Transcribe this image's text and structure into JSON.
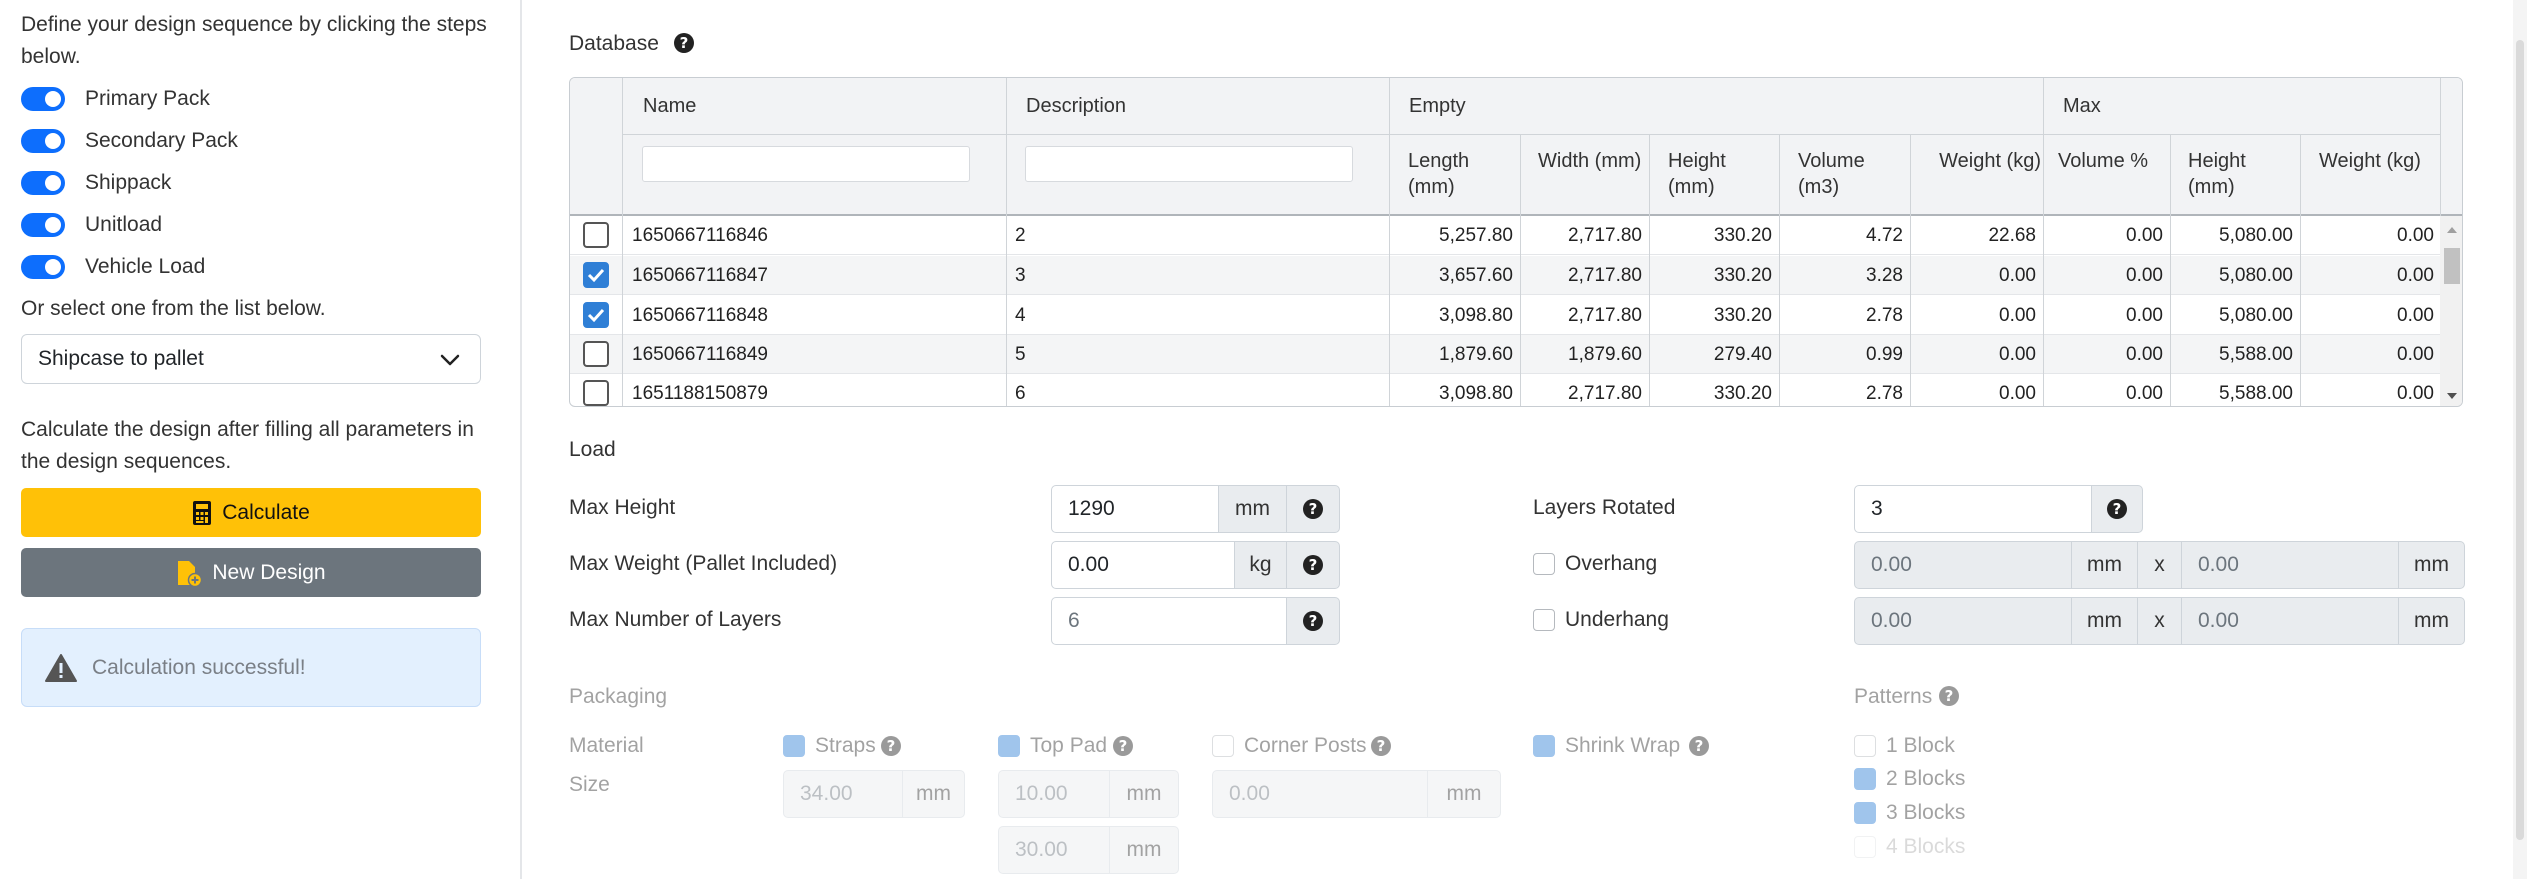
{
  "sidebar": {
    "intro": "Define your design sequence by clicking the steps below.",
    "steps": [
      {
        "label": "Primary Pack"
      },
      {
        "label": "Secondary Pack"
      },
      {
        "label": "Shippack"
      },
      {
        "label": "Unitload"
      },
      {
        "label": "Vehicle Load"
      }
    ],
    "select_intro": "Or select one from the list below.",
    "selected_sequence": "Shipcase to pallet",
    "calc_intro": "Calculate the design after filling all parameters in the design sequences.",
    "calculate_label": "Calculate",
    "new_design_label": "New Design",
    "alert_text": "Calculation successful!"
  },
  "database": {
    "title": "Database",
    "group_empty": "Empty",
    "group_max": "Max",
    "columns": {
      "name": "Name",
      "description": "Description",
      "length": "Length (mm)",
      "width": "Width (mm)",
      "height": "Height (mm)",
      "volume": "Volume (m3)",
      "weight": "Weight (kg)",
      "volume_pct": "Volume %",
      "max_height": "Height (mm)",
      "max_weight": "Weight (kg)"
    },
    "rows": [
      {
        "checked": false,
        "name": "1650667116846",
        "desc": "2",
        "length": "5,257.80",
        "width": "2,717.80",
        "height": "330.20",
        "volume": "4.72",
        "weight": "22.68",
        "vol_pct": "0.00",
        "max_height": "5,080.00",
        "max_weight": "0.00"
      },
      {
        "checked": true,
        "name": "1650667116847",
        "desc": "3",
        "length": "3,657.60",
        "width": "2,717.80",
        "height": "330.20",
        "volume": "3.28",
        "weight": "0.00",
        "vol_pct": "0.00",
        "max_height": "5,080.00",
        "max_weight": "0.00"
      },
      {
        "checked": true,
        "name": "1650667116848",
        "desc": "4",
        "length": "3,098.80",
        "width": "2,717.80",
        "height": "330.20",
        "volume": "2.78",
        "weight": "0.00",
        "vol_pct": "0.00",
        "max_height": "5,080.00",
        "max_weight": "0.00"
      },
      {
        "checked": false,
        "name": "1650667116849",
        "desc": "5",
        "length": "1,879.60",
        "width": "1,879.60",
        "height": "279.40",
        "volume": "0.99",
        "weight": "0.00",
        "vol_pct": "0.00",
        "max_height": "5,588.00",
        "max_weight": "0.00"
      },
      {
        "checked": false,
        "name": "1651188150879",
        "desc": "6",
        "length": "3,098.80",
        "width": "2,717.80",
        "height": "330.20",
        "volume": "2.78",
        "weight": "0.00",
        "vol_pct": "0.00",
        "max_height": "5,588.00",
        "max_weight": "0.00"
      }
    ]
  },
  "load": {
    "title": "Load",
    "max_height_label": "Max Height",
    "max_height_value": "1290",
    "max_height_unit": "mm",
    "max_weight_label": "Max Weight (Pallet Included)",
    "max_weight_value": "0.00",
    "max_weight_unit": "kg",
    "max_layers_label": "Max Number of Layers",
    "max_layers_value": "6",
    "layers_rotated_label": "Layers Rotated",
    "layers_rotated_value": "3",
    "overhang_label": "Overhang",
    "overhang_x": "0.00",
    "overhang_y": "0.00",
    "underhang_label": "Underhang",
    "underhang_x": "0.00",
    "underhang_y": "0.00",
    "unit_mm": "mm",
    "times": "x"
  },
  "packaging": {
    "title": "Packaging",
    "material_label": "Material",
    "size_label": "Size",
    "straps_label": "Straps",
    "top_pad_label": "Top Pad",
    "corner_posts_label": "Corner Posts",
    "shrink_wrap_label": "Shrink Wrap",
    "straps_size": "34.00",
    "top_pad_size": "10.00",
    "top_pad_size2": "30.00",
    "corner_posts_size": "0.00",
    "unit_mm": "mm"
  },
  "patterns": {
    "title": "Patterns",
    "items": [
      {
        "label": "1 Block",
        "checked": false
      },
      {
        "label": "2 Blocks",
        "checked": true
      },
      {
        "label": "3 Blocks",
        "checked": true
      },
      {
        "label": "4 Blocks",
        "checked": false
      }
    ]
  },
  "colors": {
    "primary": "#0d6efd",
    "calculate": "#ffc107",
    "secondary": "#6c757d",
    "alert_bg": "#e3f0fe"
  }
}
